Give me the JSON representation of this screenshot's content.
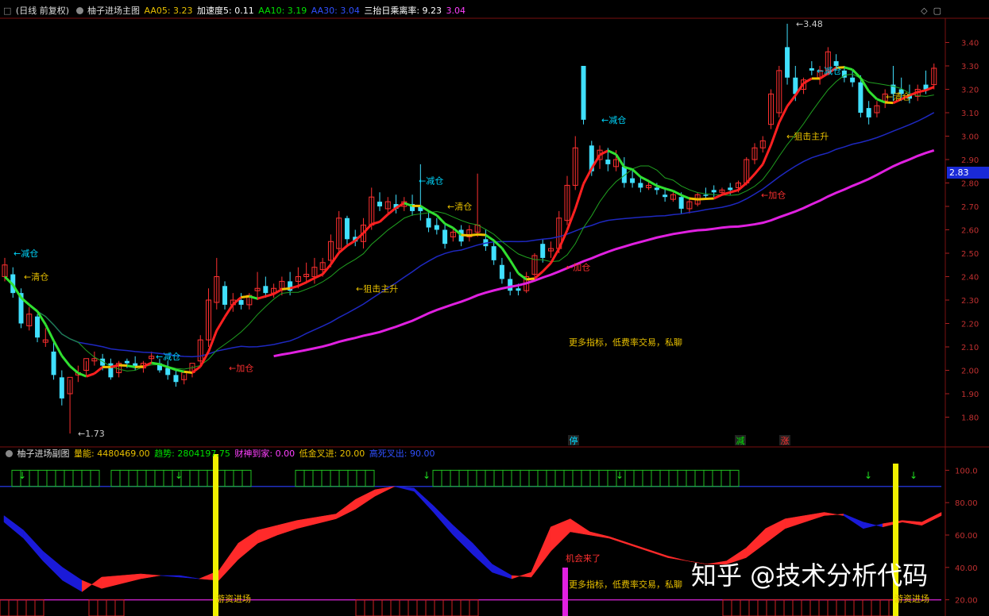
{
  "main_header": {
    "mode": "(日线 前复权)",
    "title": "柚子进场主图",
    "items": [
      {
        "label": "AA05: 3.23",
        "color": "#e8c000"
      },
      {
        "label": "加速度5: 0.11",
        "color": "#ffffff"
      },
      {
        "label": "AA10: 3.19",
        "color": "#00e000"
      },
      {
        "label": "AA30: 3.04",
        "color": "#3050ff"
      },
      {
        "label": "三抬日乘离率: 9.23",
        "color": "#ffffff"
      },
      {
        "label": "3.04",
        "color": "#ff40ff"
      }
    ]
  },
  "sub_header": {
    "title": "柚子进场副图",
    "items": [
      {
        "label": "量能: 4480469.00",
        "color": "#e8c000"
      },
      {
        "label": "趋势: 2804197.75",
        "color": "#00e000"
      },
      {
        "label": "财神到家: 0.00",
        "color": "#ff40ff"
      },
      {
        "label": "低金叉进: 20.00",
        "color": "#e8c000"
      },
      {
        "label": "高死叉出: 90.00",
        "color": "#3050ff"
      }
    ]
  },
  "current_price_tag": "2.83",
  "watermark": "知乎 @技术分析代码",
  "chart_data": [
    {
      "type": "candlestick",
      "title": "柚子进场主图",
      "y_ticks": [
        "3.40",
        "3.30",
        "3.20",
        "3.10",
        "3.00",
        "2.90",
        "2.80",
        "2.70",
        "2.60",
        "2.50",
        "2.40",
        "2.30",
        "2.20",
        "2.10",
        "2.00",
        "1.90",
        "1.80"
      ],
      "ylim": [
        1.7,
        3.5
      ],
      "candles": [
        [
          2.45,
          2.48,
          2.4,
          2.38,
          "u"
        ],
        [
          2.41,
          2.44,
          2.33,
          2.31,
          "d"
        ],
        [
          2.33,
          2.35,
          2.2,
          2.18,
          "d"
        ],
        [
          2.24,
          2.27,
          2.19,
          2.17,
          "u"
        ],
        [
          2.23,
          2.24,
          2.14,
          2.12,
          "d"
        ],
        [
          2.13,
          2.18,
          2.12,
          2.1,
          "u"
        ],
        [
          2.08,
          2.12,
          1.98,
          1.96,
          "d"
        ],
        [
          1.97,
          2.0,
          1.88,
          1.85,
          "d"
        ],
        [
          1.9,
          1.96,
          1.97,
          1.73,
          "u"
        ],
        [
          1.98,
          2.02,
          1.99,
          1.95,
          "u"
        ],
        [
          2.0,
          2.04,
          2.05,
          1.98,
          "u"
        ],
        [
          2.05,
          2.08,
          2.04,
          2.02,
          "u"
        ],
        [
          2.05,
          2.07,
          2.02,
          2.0,
          "d"
        ],
        [
          2.03,
          2.05,
          1.97,
          1.96,
          "d"
        ],
        [
          1.99,
          2.04,
          2.03,
          1.97,
          "u"
        ],
        [
          2.03,
          2.05,
          2.04,
          2.01,
          "d"
        ],
        [
          2.03,
          2.06,
          2.01,
          2.0,
          "d"
        ],
        [
          2.01,
          2.04,
          2.03,
          1.99,
          "u"
        ],
        [
          2.06,
          2.08,
          2.05,
          2.03,
          "u"
        ],
        [
          2.03,
          2.05,
          2.0,
          1.99,
          "d"
        ],
        [
          2.01,
          2.04,
          1.98,
          1.96,
          "d"
        ],
        [
          1.98,
          2.0,
          1.95,
          1.93,
          "d"
        ],
        [
          1.96,
          1.98,
          1.99,
          1.94,
          "u"
        ],
        [
          1.99,
          2.02,
          2.03,
          1.97,
          "u"
        ],
        [
          2.04,
          2.15,
          2.13,
          2.02,
          "u"
        ],
        [
          2.13,
          2.35,
          2.3,
          2.1,
          "u"
        ],
        [
          2.29,
          2.48,
          2.4,
          2.26,
          "u"
        ],
        [
          2.36,
          2.38,
          2.28,
          2.26,
          "d"
        ],
        [
          2.28,
          2.33,
          2.3,
          2.25,
          "u"
        ],
        [
          2.3,
          2.33,
          2.28,
          2.26,
          "d"
        ],
        [
          2.28,
          2.33,
          2.32,
          2.26,
          "u"
        ],
        [
          2.34,
          2.42,
          2.35,
          2.3,
          "u"
        ],
        [
          2.36,
          2.4,
          2.33,
          2.31,
          "d"
        ],
        [
          2.33,
          2.37,
          2.35,
          2.31,
          "u"
        ],
        [
          2.35,
          2.4,
          2.38,
          2.32,
          "u"
        ],
        [
          2.38,
          2.42,
          2.34,
          2.32,
          "d"
        ],
        [
          2.38,
          2.44,
          2.4,
          2.35,
          "u"
        ],
        [
          2.4,
          2.46,
          2.41,
          2.37,
          "u"
        ],
        [
          2.4,
          2.48,
          2.44,
          2.37,
          "u"
        ],
        [
          2.43,
          2.48,
          2.46,
          2.4,
          "u"
        ],
        [
          2.47,
          2.58,
          2.55,
          2.44,
          "u"
        ],
        [
          2.52,
          2.68,
          2.65,
          2.5,
          "u"
        ],
        [
          2.65,
          2.66,
          2.56,
          2.53,
          "d"
        ],
        [
          2.57,
          2.6,
          2.55,
          2.53,
          "d"
        ],
        [
          2.55,
          2.65,
          2.62,
          2.52,
          "u"
        ],
        [
          2.62,
          2.78,
          2.74,
          2.6,
          "u"
        ],
        [
          2.72,
          2.76,
          2.7,
          2.68,
          "d"
        ],
        [
          2.69,
          2.74,
          2.72,
          2.67,
          "u"
        ],
        [
          2.71,
          2.75,
          2.69,
          2.67,
          "d"
        ],
        [
          2.7,
          2.74,
          2.72,
          2.68,
          "u"
        ],
        [
          2.71,
          2.75,
          2.68,
          2.66,
          "d"
        ],
        [
          2.68,
          2.88,
          2.7,
          2.64,
          "d"
        ],
        [
          2.65,
          2.68,
          2.61,
          2.59,
          "d"
        ],
        [
          2.62,
          2.65,
          2.6,
          2.58,
          "d"
        ],
        [
          2.6,
          2.63,
          2.54,
          2.52,
          "d"
        ],
        [
          2.57,
          2.61,
          2.59,
          2.55,
          "u"
        ],
        [
          2.6,
          2.62,
          2.55,
          2.53,
          "d"
        ],
        [
          2.57,
          2.62,
          2.6,
          2.55,
          "u"
        ],
        [
          2.59,
          2.84,
          2.62,
          2.57,
          "u"
        ],
        [
          2.56,
          2.6,
          2.53,
          2.51,
          "d"
        ],
        [
          2.53,
          2.56,
          2.47,
          2.45,
          "d"
        ],
        [
          2.45,
          2.48,
          2.39,
          2.37,
          "d"
        ],
        [
          2.39,
          2.42,
          2.34,
          2.32,
          "d"
        ],
        [
          2.35,
          2.37,
          2.34,
          2.32,
          "d"
        ],
        [
          2.34,
          2.42,
          2.4,
          2.33,
          "u"
        ],
        [
          2.41,
          2.5,
          2.49,
          2.4,
          "u"
        ],
        [
          2.48,
          2.56,
          2.54,
          2.46,
          "d"
        ],
        [
          2.51,
          2.55,
          2.52,
          2.48,
          "u"
        ],
        [
          2.52,
          2.68,
          2.65,
          2.5,
          "u"
        ],
        [
          2.64,
          2.83,
          2.79,
          2.62,
          "u"
        ],
        [
          2.79,
          3.0,
          2.95,
          2.77,
          "u"
        ],
        [
          3.3,
          3.3,
          3.07,
          3.05,
          "d"
        ],
        [
          2.96,
          2.98,
          2.85,
          2.83,
          "d"
        ],
        [
          2.9,
          2.96,
          2.94,
          2.86,
          "u"
        ],
        [
          2.9,
          2.95,
          2.88,
          2.85,
          "d"
        ],
        [
          2.9,
          2.94,
          2.87,
          2.85,
          "u"
        ],
        [
          2.87,
          2.91,
          2.8,
          2.78,
          "d"
        ],
        [
          2.82,
          2.86,
          2.8,
          2.78,
          "d"
        ],
        [
          2.8,
          2.83,
          2.78,
          2.76,
          "d"
        ],
        [
          2.78,
          2.81,
          2.79,
          2.77,
          "u"
        ],
        [
          2.78,
          2.8,
          2.77,
          2.75,
          "d"
        ],
        [
          2.75,
          2.78,
          2.74,
          2.72,
          "d"
        ],
        [
          2.73,
          2.76,
          2.75,
          2.72,
          "u"
        ],
        [
          2.74,
          2.76,
          2.69,
          2.67,
          "d"
        ],
        [
          2.69,
          2.74,
          2.72,
          2.67,
          "u"
        ],
        [
          2.71,
          2.76,
          2.75,
          2.7,
          "u"
        ],
        [
          2.75,
          2.78,
          2.75,
          2.73,
          "d"
        ],
        [
          2.77,
          2.79,
          2.76,
          2.74,
          "d"
        ],
        [
          2.76,
          2.78,
          2.77,
          2.75,
          "u"
        ],
        [
          2.78,
          2.8,
          2.77,
          2.75,
          "d"
        ],
        [
          2.78,
          2.81,
          2.8,
          2.76,
          "u"
        ],
        [
          2.8,
          2.91,
          2.9,
          2.79,
          "u"
        ],
        [
          2.9,
          2.97,
          2.95,
          2.88,
          "u"
        ],
        [
          2.95,
          3.0,
          2.98,
          2.93,
          "u"
        ],
        [
          3.05,
          3.2,
          3.18,
          3.03,
          "u"
        ],
        [
          3.1,
          3.3,
          3.28,
          3.08,
          "u"
        ],
        [
          3.38,
          3.48,
          3.25,
          3.22,
          "d"
        ],
        [
          3.25,
          3.3,
          3.18,
          3.15,
          "d"
        ],
        [
          3.2,
          3.25,
          3.24,
          3.18,
          "u"
        ],
        [
          3.29,
          3.32,
          3.28,
          3.26,
          "d"
        ],
        [
          3.25,
          3.3,
          3.28,
          3.22,
          "u"
        ],
        [
          3.28,
          3.38,
          3.36,
          3.26,
          "u"
        ],
        [
          3.32,
          3.35,
          3.3,
          3.28,
          "d"
        ],
        [
          3.28,
          3.3,
          3.25,
          3.23,
          "d"
        ],
        [
          3.25,
          3.28,
          3.23,
          3.21,
          "d"
        ],
        [
          3.23,
          3.26,
          3.1,
          3.08,
          "d"
        ],
        [
          3.12,
          3.15,
          3.08,
          3.05,
          "d"
        ],
        [
          3.1,
          3.15,
          3.13,
          3.08,
          "u"
        ],
        [
          3.15,
          3.2,
          3.18,
          3.12,
          "u"
        ],
        [
          3.18,
          3.3,
          3.22,
          3.15,
          "d"
        ],
        [
          3.2,
          3.25,
          3.18,
          3.15,
          "d"
        ],
        [
          3.18,
          3.22,
          3.16,
          3.14,
          "d"
        ],
        [
          3.17,
          3.22,
          3.2,
          3.15,
          "u"
        ],
        [
          3.2,
          3.28,
          3.22,
          3.18,
          "d"
        ],
        [
          3.22,
          3.31,
          3.29,
          3.2,
          "u"
        ]
      ],
      "annotations": [
        {
          "text": "←减仓",
          "color": "#00d8ff",
          "x": 17,
          "y": 2.5
        },
        {
          "text": "←清仓",
          "color": "#e8c000",
          "x": 30,
          "y": 2.4
        },
        {
          "text": "←1.73",
          "color": "#cccccc",
          "x": 98,
          "y": 1.73
        },
        {
          "text": "←减仓",
          "color": "#00d8ff",
          "x": 196,
          "y": 2.06
        },
        {
          "text": "←加仓",
          "color": "#ff3030",
          "x": 288,
          "y": 2.01
        },
        {
          "text": "←狙击主升",
          "color": "#e8c000",
          "x": 448,
          "y": 2.35
        },
        {
          "text": "←减仓",
          "color": "#00d8ff",
          "x": 527,
          "y": 2.81
        },
        {
          "text": "←清仓",
          "color": "#e8c000",
          "x": 563,
          "y": 2.7
        },
        {
          "text": "←加仓",
          "color": "#ff3030",
          "x": 712,
          "y": 2.44
        },
        {
          "text": "更多指标，低费率交易，私聊",
          "color": "#e8c000",
          "x": 716,
          "y": 2.12
        },
        {
          "text": "←减仓",
          "color": "#00d8ff",
          "x": 757,
          "y": 3.07
        },
        {
          "text": "←加仓",
          "color": "#ff3030",
          "x": 958,
          "y": 2.75
        },
        {
          "text": "←狙击主升",
          "color": "#e8c000",
          "x": 990,
          "y": 3.0
        },
        {
          "text": "←减仓",
          "color": "#00d8ff",
          "x": 1028,
          "y": 3.28
        },
        {
          "text": "←3.48",
          "color": "#cccccc",
          "x": 1002,
          "y": 3.48
        },
        {
          "text": "←清仓",
          "color": "#e8c000",
          "x": 1115,
          "y": 3.17
        }
      ],
      "bottom_tags": [
        {
          "text": "停",
          "color": "#00d8ff",
          "x": 722
        },
        {
          "text": "减",
          "color": "#00e000",
          "x": 932
        },
        {
          "text": "涨",
          "color": "#ff3030",
          "x": 988
        }
      ]
    },
    {
      "type": "area",
      "title": "柚子进场副图",
      "y_ticks": [
        "100.0",
        "80.00",
        "60.00",
        "40.00",
        "20.00"
      ],
      "ylim": [
        10,
        110
      ],
      "ma_line": [
        72,
        63,
        50,
        40,
        32,
        27,
        30,
        33,
        35,
        35,
        33,
        32,
        45,
        55,
        60,
        64,
        67,
        70,
        76,
        84,
        90,
        89,
        78,
        66,
        55,
        42,
        35,
        34,
        50,
        62,
        60,
        58,
        54,
        50,
        46,
        44,
        42,
        42,
        46,
        55,
        64,
        68,
        72,
        73,
        68,
        65,
        68,
        66,
        72
      ],
      "fast_line": [
        68,
        58,
        44,
        32,
        25,
        34,
        35,
        36,
        35,
        34,
        33,
        38,
        55,
        63,
        66,
        69,
        71,
        73,
        82,
        88,
        90,
        87,
        74,
        60,
        48,
        37,
        33,
        37,
        65,
        70,
        62,
        59,
        55,
        51,
        47,
        44,
        42,
        44,
        52,
        64,
        70,
        72,
        74,
        72,
        64,
        67,
        69,
        68,
        74
      ],
      "entry_labels": [
        {
          "text": "游资进场",
          "color": "#e8c000",
          "x": 272
        },
        {
          "text": "机会来了",
          "color": "#ff3030",
          "x": 712
        },
        {
          "text": "更多指标，低费率交易，私聊",
          "color": "#e8c000",
          "x": 716
        },
        {
          "text": "游资进场",
          "color": "#e8c000",
          "x": 1126
        }
      ]
    }
  ]
}
